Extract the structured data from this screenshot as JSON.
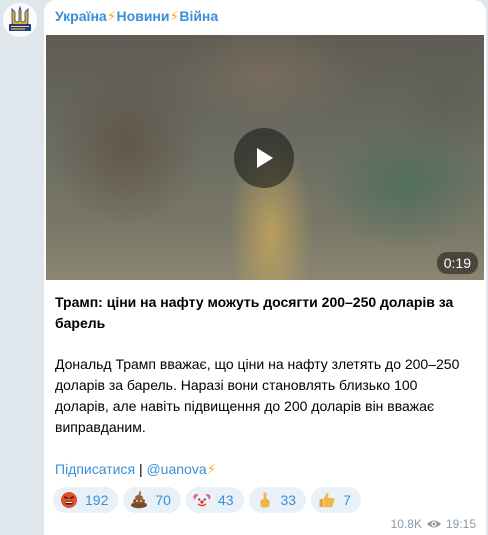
{
  "channel": {
    "name_parts": [
      "Україна",
      "Новини",
      "Війна"
    ],
    "separator": "⚡",
    "avatar_icon": "trident-logo-icon"
  },
  "media": {
    "duration": "0:19",
    "play_icon": "play-icon"
  },
  "post": {
    "title": "Трамп: ціни на нафту можуть досягти 200–250 доларів за барель",
    "body": "Дональд Трамп вважає, що ціни на нафту злетять до 200–250 доларів за барель. Наразі вони становлять близько 100 доларів, але навіть підвищення до 200 доларів він вважає виправданим.",
    "subscribe_link": "Підписатися",
    "divider": "|",
    "handle_link": "@uanova",
    "handle_emoji": "⚡"
  },
  "reactions": [
    {
      "icon": "angry-face-icon",
      "count": "192"
    },
    {
      "icon": "poop-icon",
      "count": "70"
    },
    {
      "icon": "clown-face-icon",
      "count": "43"
    },
    {
      "icon": "middle-finger-icon",
      "count": "33"
    },
    {
      "icon": "thumbs-up-icon",
      "count": "7"
    }
  ],
  "meta": {
    "views": "10.8K",
    "views_icon": "eye-icon",
    "time": "19:15"
  },
  "colors": {
    "link": "#3a8fd8",
    "reaction_bg": "#e8f0f8",
    "lightning": "#f5b323",
    "background": "#dfe6ec"
  }
}
